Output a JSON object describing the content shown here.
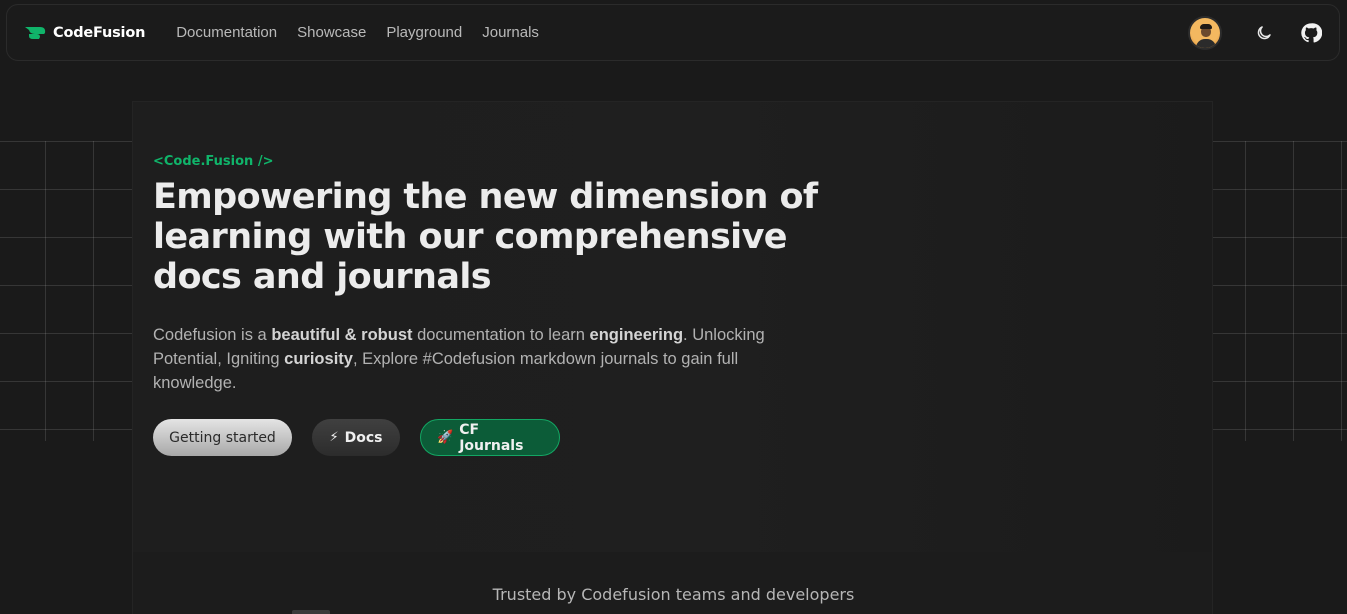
{
  "brand": {
    "name": "CodeFusion",
    "accent": "#10b46a"
  },
  "nav": {
    "links": [
      "Documentation",
      "Showcase",
      "Playground",
      "Journals"
    ],
    "icons": [
      "avatar",
      "moon-icon",
      "github-icon"
    ]
  },
  "hero": {
    "tag": "<Code.Fusion />",
    "headline_lines": [
      "Empowering the new dimension of",
      "learning with our comprehensive",
      "docs and journals"
    ],
    "description": {
      "p1": "Codefusion is a ",
      "b1": "beautiful & robust",
      "p2": " documentation to learn ",
      "b2": "engineering",
      "p3": ". Unlocking Potential, Igniting ",
      "b3": "curiosity",
      "p4": ", Explore #Codefusion markdown journals to gain full knowledge."
    },
    "buttons": {
      "start": "Getting started",
      "docs_emoji": "⚡",
      "docs": "Docs",
      "journals_emoji": "🚀",
      "journals": "CF Journals"
    }
  },
  "trusted": "Trusted by Codefusion teams and developers"
}
